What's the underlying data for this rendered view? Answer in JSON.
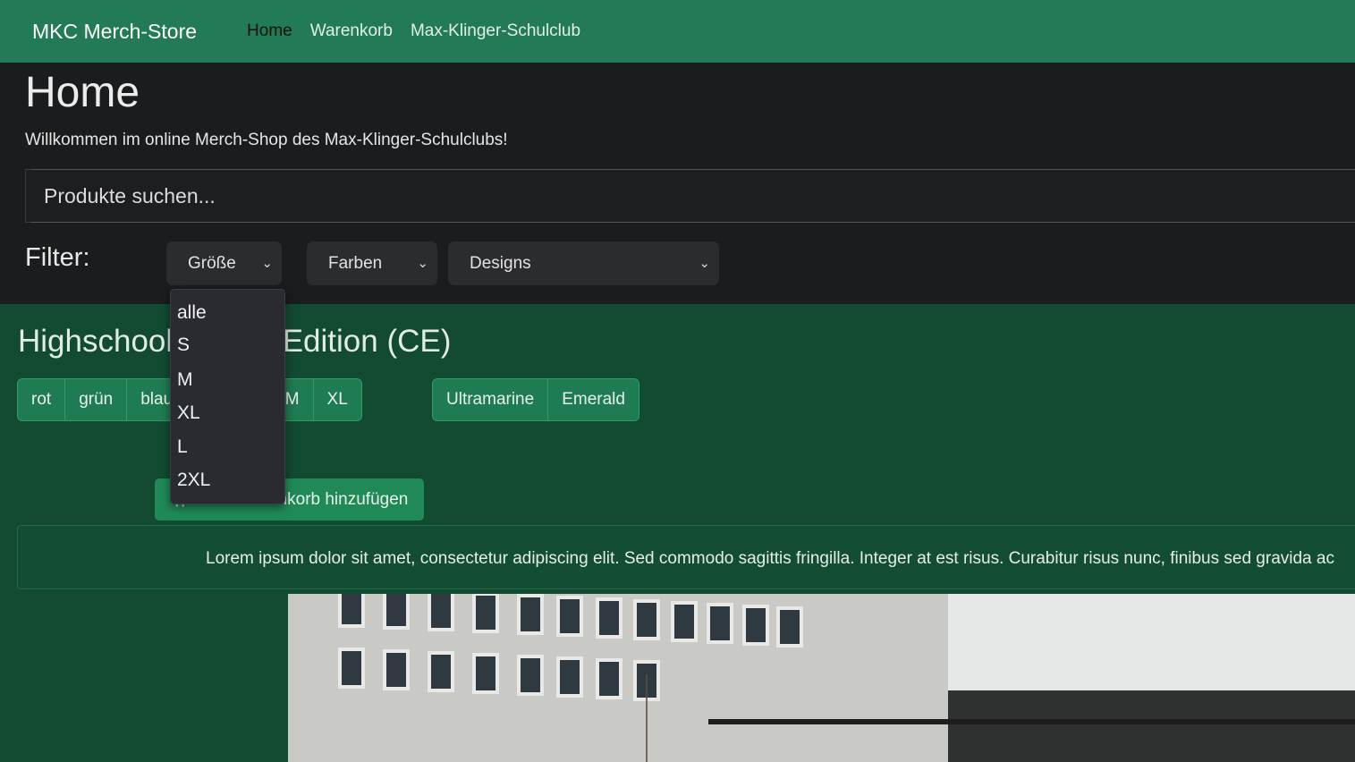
{
  "navbar": {
    "brand": "MKC Merch-Store",
    "links": [
      {
        "label": "Home"
      },
      {
        "label": "Warenkorb"
      },
      {
        "label": "Max-Klinger-Schulclub"
      }
    ]
  },
  "hero": {
    "title": "Home",
    "welcome": "Willkommen im online Merch-Shop des Max-Klinger-Schulclubs!",
    "search_placeholder": "Produkte suchen...",
    "filter_label": "Filter:",
    "selects": {
      "size": "Größe",
      "colors": "Farben",
      "designs": "Designs"
    }
  },
  "size_dropdown": {
    "options": [
      "alle",
      "S",
      "M",
      "XL",
      "L",
      "2XL"
    ]
  },
  "product": {
    "title": "Highschool Colour Edition (CE)",
    "colors": [
      "rot",
      "grün",
      "blau"
    ],
    "sizes": [
      "S",
      "M",
      "XL"
    ],
    "designs": [
      "Ultramarine",
      "Emerald"
    ],
    "cart_button": "Zum Warenkorb hinzufügen",
    "description": "Lorem ipsum dolor sit amet, consectetur adipiscing elit. Sed commodo sagittis fringilla. Integer at est risus. Curabitur risus nunc, finibus sed gravida ac"
  },
  "colors": {
    "navbar": "#227b56",
    "hero_bg": "#1b1c1e",
    "main_bg": "#124b32",
    "button": "#1f7b51"
  }
}
